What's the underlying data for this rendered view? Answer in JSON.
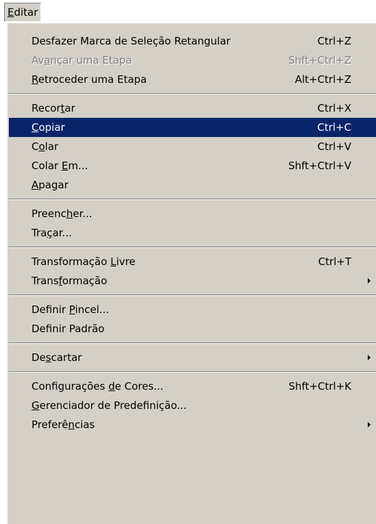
{
  "menubar": {
    "label_access": "E",
    "label_rest": "ditar"
  },
  "menu": {
    "items": [
      {
        "type": "item",
        "name": "undo",
        "pre": "Desfazer Marca de Seleção Retangular",
        "ul": "",
        "post": "",
        "shortcut": "Ctrl+Z"
      },
      {
        "type": "item",
        "name": "step-forward",
        "pre": "Av",
        "ul": "a",
        "post": "nçar uma Etapa",
        "shortcut": "Shft+Ctrl+Z",
        "disabled": true
      },
      {
        "type": "item",
        "name": "step-backward",
        "pre": "",
        "ul": "R",
        "post": "etroceder uma Etapa",
        "shortcut": "Alt+Ctrl+Z"
      },
      {
        "type": "separator"
      },
      {
        "type": "item",
        "name": "cut",
        "pre": "Recor",
        "ul": "t",
        "post": "ar",
        "shortcut": "Ctrl+X"
      },
      {
        "type": "item",
        "name": "copy",
        "pre": "",
        "ul": "C",
        "post": "opiar",
        "shortcut": "Ctrl+C",
        "selected": true
      },
      {
        "type": "item",
        "name": "paste",
        "pre": "C",
        "ul": "o",
        "post": "lar",
        "shortcut": "Ctrl+V"
      },
      {
        "type": "item",
        "name": "paste-into",
        "pre": "Colar ",
        "ul": "E",
        "post": "m...",
        "shortcut": "Shft+Ctrl+V"
      },
      {
        "type": "item",
        "name": "clear",
        "pre": "",
        "ul": "A",
        "post": "pagar",
        "shortcut": ""
      },
      {
        "type": "separator"
      },
      {
        "type": "item",
        "name": "fill",
        "pre": "Preenc",
        "ul": "h",
        "post": "er...",
        "shortcut": ""
      },
      {
        "type": "item",
        "name": "stroke",
        "pre": "Tra",
        "ul": "ç",
        "post": "ar...",
        "shortcut": ""
      },
      {
        "type": "separator"
      },
      {
        "type": "item",
        "name": "free-transform",
        "pre": "Transformação ",
        "ul": "L",
        "post": "ivre",
        "shortcut": "Ctrl+T"
      },
      {
        "type": "item",
        "name": "transform",
        "pre": "Trans",
        "ul": "f",
        "post": "ormação",
        "shortcut": "",
        "submenu": true
      },
      {
        "type": "separator"
      },
      {
        "type": "item",
        "name": "define-brush",
        "pre": "Definir ",
        "ul": "P",
        "post": "incel...",
        "shortcut": ""
      },
      {
        "type": "item",
        "name": "define-pattern",
        "pre": "Def",
        "ul": "i",
        "post": "nir Padrão",
        "shortcut": ""
      },
      {
        "type": "separator"
      },
      {
        "type": "item",
        "name": "purge",
        "pre": "De",
        "ul": "s",
        "post": "cartar",
        "shortcut": "",
        "submenu": true
      },
      {
        "type": "separator"
      },
      {
        "type": "item",
        "name": "color-settings",
        "pre": "Configurações ",
        "ul": "d",
        "post": "e Cores...",
        "shortcut": "Shft+Ctrl+K"
      },
      {
        "type": "item",
        "name": "preset-manager",
        "pre": "",
        "ul": "G",
        "post": "erenciador de Predefinição...",
        "shortcut": ""
      },
      {
        "type": "item",
        "name": "preferences",
        "pre": "Preferê",
        "ul": "n",
        "post": "cias",
        "shortcut": "",
        "submenu": true
      }
    ]
  }
}
